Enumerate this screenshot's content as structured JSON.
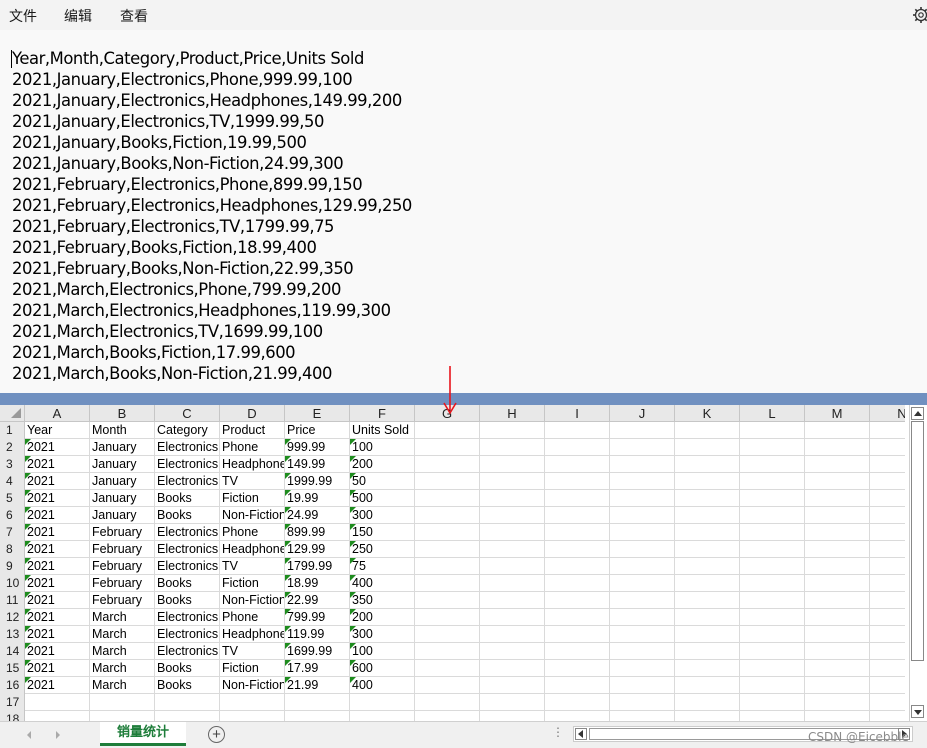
{
  "menu": {
    "file": "文件",
    "edit": "编辑",
    "view": "查看",
    "settings_icon": "gear-icon"
  },
  "editor": {
    "lines": [
      "Year,Month,Category,Product,Price,Units Sold",
      "2021,January,Electronics,Phone,999.99,100",
      "2021,January,Electronics,Headphones,149.99,200",
      "2021,January,Electronics,TV,1999.99,50",
      "2021,January,Books,Fiction,19.99,500",
      "2021,January,Books,Non-Fiction,24.99,300",
      "2021,February,Electronics,Phone,899.99,150",
      "2021,February,Electronics,Headphones,129.99,250",
      "2021,February,Electronics,TV,1799.99,75",
      "2021,February,Books,Fiction,18.99,400",
      "2021,February,Books,Non-Fiction,22.99,350",
      "2021,March,Electronics,Phone,799.99,200",
      "2021,March,Electronics,Headphones,119.99,300",
      "2021,March,Electronics,TV,1699.99,100",
      "2021,March,Books,Fiction,17.99,600",
      "2021,March,Books,Non-Fiction,21.99,400"
    ]
  },
  "sheet": {
    "columns": [
      "A",
      "B",
      "C",
      "D",
      "E",
      "F",
      "G",
      "H",
      "I",
      "J",
      "K",
      "L",
      "M",
      "N"
    ],
    "row_numbers": [
      "1",
      "2",
      "3",
      "4",
      "5",
      "6",
      "7",
      "8",
      "9",
      "10",
      "11",
      "12",
      "13",
      "14",
      "15",
      "16",
      "17",
      "18"
    ],
    "rows": [
      [
        "Year",
        "Month",
        "Category",
        "Product",
        "Price",
        "Units Sold"
      ],
      [
        "2021",
        "January",
        "Electronics",
        "Phone",
        "999.99",
        "100"
      ],
      [
        "2021",
        "January",
        "Electronics",
        "Headphones",
        "149.99",
        "200"
      ],
      [
        "2021",
        "January",
        "Electronics",
        "TV",
        "1999.99",
        "50"
      ],
      [
        "2021",
        "January",
        "Books",
        "Fiction",
        "19.99",
        "500"
      ],
      [
        "2021",
        "January",
        "Books",
        "Non-Fiction",
        "24.99",
        "300"
      ],
      [
        "2021",
        "February",
        "Electronics",
        "Phone",
        "899.99",
        "150"
      ],
      [
        "2021",
        "February",
        "Electronics",
        "Headphones",
        "129.99",
        "250"
      ],
      [
        "2021",
        "February",
        "Electronics",
        "TV",
        "1799.99",
        "75"
      ],
      [
        "2021",
        "February",
        "Books",
        "Fiction",
        "18.99",
        "400"
      ],
      [
        "2021",
        "February",
        "Books",
        "Non-Fiction",
        "22.99",
        "350"
      ],
      [
        "2021",
        "March",
        "Electronics",
        "Phone",
        "799.99",
        "200"
      ],
      [
        "2021",
        "March",
        "Electronics",
        "Headphones",
        "119.99",
        "300"
      ],
      [
        "2021",
        "March",
        "Electronics",
        "TV",
        "1699.99",
        "100"
      ],
      [
        "2021",
        "March",
        "Books",
        "Fiction",
        "17.99",
        "600"
      ],
      [
        "2021",
        "March",
        "Books",
        "Non-Fiction",
        "21.99",
        "400"
      ]
    ],
    "tab_label": "销量统计",
    "add_sheet": "+",
    "dots": "⋮",
    "flag_color": "#1e8c1e",
    "tab_color": "#1e7d3a",
    "annotation_color": "#e8141c"
  },
  "watermark": "CSDN @Eicebble"
}
